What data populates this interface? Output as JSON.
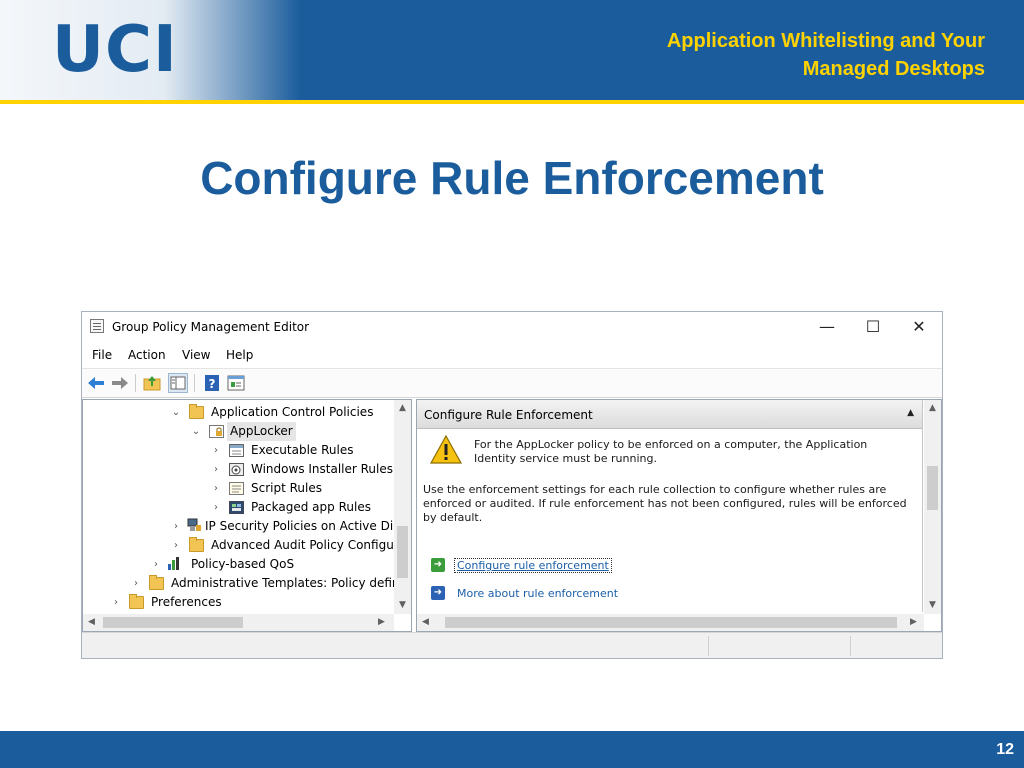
{
  "slide": {
    "logo_text": "UCI",
    "header_title_line1": "Application Whitelisting and Your",
    "header_title_line2": "Managed Desktops",
    "title": "Configure Rule Enforcement",
    "page_number": "12",
    "colors": {
      "brand_blue": "#1b5d9c",
      "brand_gold": "#ffd200"
    }
  },
  "window": {
    "title": "Group Policy Management Editor",
    "controls": {
      "minimize": "—",
      "maximize": "☐",
      "close": "✕"
    },
    "menu": [
      "File",
      "Action",
      "View",
      "Help"
    ],
    "toolbar_icons": [
      "back-arrow-icon",
      "forward-arrow-icon",
      "up-folder-icon",
      "show-hide-tree-icon",
      "help-icon",
      "properties-icon"
    ]
  },
  "tree": {
    "items": [
      {
        "label": "Application Control Policies",
        "expanded": true,
        "icon": "folder-icon"
      },
      {
        "label": "AppLocker",
        "expanded": true,
        "selected": true,
        "icon": "applocker-icon"
      },
      {
        "label": "Executable Rules",
        "expanded": false,
        "icon": "executable-rules-icon"
      },
      {
        "label": "Windows Installer Rules",
        "expanded": false,
        "icon": "installer-rules-icon"
      },
      {
        "label": "Script Rules",
        "expanded": false,
        "icon": "script-rules-icon"
      },
      {
        "label": "Packaged app Rules",
        "expanded": false,
        "icon": "packaged-app-rules-icon"
      },
      {
        "label": "IP Security Policies on Active Dir",
        "expanded": false,
        "icon": "ip-security-icon"
      },
      {
        "label": "Advanced Audit Policy Configur",
        "expanded": false,
        "icon": "folder-icon"
      },
      {
        "label": "Policy-based QoS",
        "expanded": false,
        "icon": "qos-chart-icon"
      },
      {
        "label": "Administrative Templates: Policy defini",
        "expanded": false,
        "icon": "folder-icon"
      },
      {
        "label": "Preferences",
        "expanded": false,
        "icon": "folder-icon"
      }
    ]
  },
  "detail": {
    "header": "Configure Rule Enforcement",
    "warning_line1": "For the AppLocker policy to be enforced on a computer, the Application",
    "warning_line2": "Identity service must be running.",
    "body_line1": "Use the enforcement settings for each rule collection to configure whether rules are",
    "body_line2": "enforced or audited. If rule enforcement has not been configured, rules will be enforced",
    "body_line3": "by default.",
    "links": [
      {
        "label": "Configure rule enforcement",
        "icon": "green-arrow-icon",
        "focused": true
      },
      {
        "label": "More about rule enforcement",
        "icon": "blue-arrow-icon",
        "focused": false
      }
    ]
  }
}
